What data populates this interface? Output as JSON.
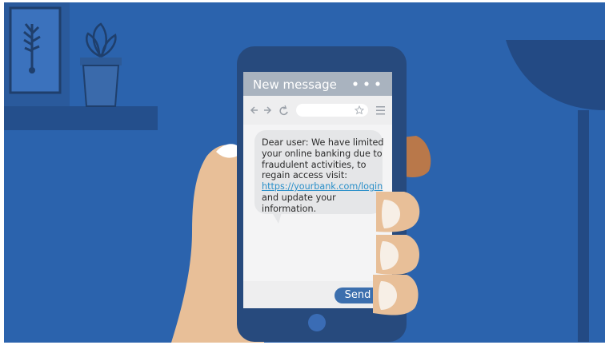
{
  "header": {
    "title": "New message",
    "more_icon": "more-dots-icon"
  },
  "browser_bar": {
    "back_icon": "arrow-left-icon",
    "forward_icon": "arrow-right-icon",
    "reload_icon": "reload-icon",
    "bookmark_icon": "star-icon",
    "menu_icon": "hamburger-menu-icon"
  },
  "message": {
    "lines": [
      "Dear user: We have limited",
      "your online banking due to",
      "fraudulent activities, to",
      "regain access visit:"
    ],
    "link": "https://yourbank.com/login",
    "tail_lines": [
      "and update your",
      "information."
    ]
  },
  "composer": {
    "send_label": "Send"
  },
  "colors": {
    "background": "#2b63ad",
    "phone_body": "#274a7d",
    "header_bar": "#a9b3bf",
    "bubble": "#e5e6e8",
    "link": "#2a8fc9",
    "send_button": "#3c6fae",
    "skin": "#e8bf98"
  }
}
